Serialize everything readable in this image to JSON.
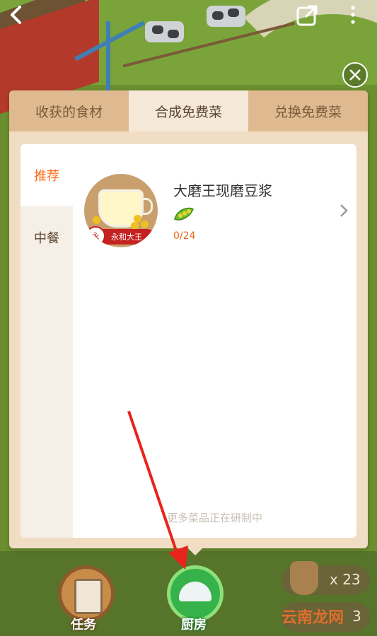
{
  "top_bar": {
    "back_icon": "chevron-left-icon",
    "share_icon": "external-link-icon",
    "more_icon": "more-vertical-icon"
  },
  "dialog": {
    "tabs": [
      {
        "label": "收获的食材",
        "active": false
      },
      {
        "label": "合成免费菜",
        "active": true
      },
      {
        "label": "兑换免费菜",
        "active": false
      }
    ],
    "categories": [
      {
        "label": "推荐",
        "active": true
      },
      {
        "label": "中餐",
        "active": false
      }
    ],
    "dishes": [
      {
        "name": "大磨王现磨豆浆",
        "brand": "永和大王",
        "ingredient_icon": "pea-pod-icon",
        "progress_text": "0/24"
      }
    ],
    "footer_note": "更多菜品正在研制中",
    "close_icon": "close-icon"
  },
  "bottom_nav": {
    "task_label": "任务",
    "kitchen_label": "厨房",
    "bag_count": "x 23",
    "second_count": "3",
    "watermark": "云南龙网"
  },
  "colors": {
    "accent": "#ff6b1a",
    "dialog_bg": "#f1ddc4",
    "tab_inactive": "#dfb98f",
    "arrow": "#e8231c"
  }
}
